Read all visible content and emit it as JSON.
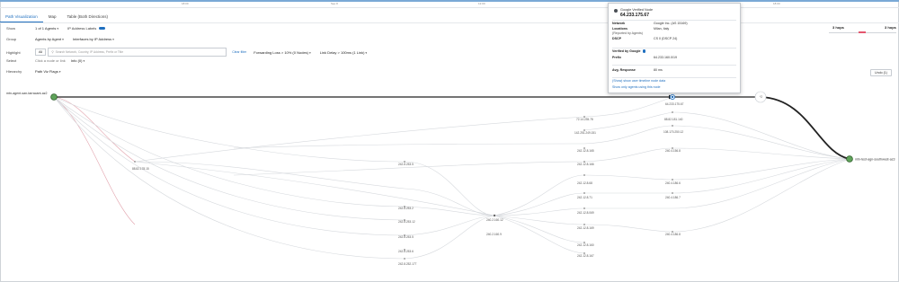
{
  "timeline": {
    "labels": [
      "18:00",
      "Sep 8",
      "12:00",
      "18:00"
    ]
  },
  "tabs": [
    {
      "label": "Path Visualization",
      "active": true
    },
    {
      "label": "Map",
      "active": false
    },
    {
      "label": "Table (Both Directions)",
      "active": false
    }
  ],
  "controls": {
    "show_label": "Show",
    "show_value": "1 of 1 Agents",
    "ip_labels": "IP Address Labels",
    "group_label": "Group",
    "group_value1": "Agents by Agent",
    "group_value2": "Interfaces by IP Address",
    "highlight_label": "Highlight",
    "highlight_select": "All",
    "highlight_placeholder": "Search Network, Country, IP Address, Prefix or Title",
    "clear_link": "Clear filter",
    "forwarding_loss": "Forwarding Loss > 10%  (0 Nodes)",
    "link_delay": "Link Delay > 100ms  (1 Link)",
    "select_label": "Select",
    "select_hint": "Click a node or link",
    "info_value": "Info (0)",
    "hierarchy_label": "Hierarchy",
    "hierarchy_value": "Path Viz Flags",
    "undo_label": "Undo (1)"
  },
  "hops": {
    "left": "3 hops",
    "right": "3 hops"
  },
  "popup": {
    "title": "Google Verified Node",
    "ip": "64.233.175.67",
    "network_label": "Network",
    "network_value": "Google Inc. (AS 15169)",
    "location_label": "Locations",
    "location_value": "Milan, Italy",
    "location_note": "(Reported by Agents)",
    "dscp_label": "DSCP",
    "dscp_value": "CS 0 (DSCP 24)",
    "verified_label": "Verified by Google",
    "prefix_label": "Prefix",
    "prefix_value": "64.233.160.0/19",
    "avg_label": "Avg. Response",
    "avg_value": "80 ms",
    "link1": "(Show) show user timeline node data",
    "link2": "Show only agents using this node"
  },
  "graph": {
    "source_label": "mtn-agent-san-tarracant-az2",
    "dest_label": "mtn-test-agn-southwest-az3",
    "nodes": [
      {
        "id": "n1",
        "label": "64.233.175.67"
      },
      {
        "id": "n2",
        "label": "72.14.235.78"
      },
      {
        "id": "n3",
        "label": "142.251.249.151"
      },
      {
        "id": "n4",
        "label": "88.82.178.15"
      },
      {
        "id": "n5",
        "label": "242.8.253.5"
      },
      {
        "id": "n6",
        "label": "242.8.253.2"
      },
      {
        "id": "n7",
        "label": "242.8.253.12"
      },
      {
        "id": "n8",
        "label": "242.8.253.5"
      },
      {
        "id": "n9",
        "label": "242.8.253.6"
      },
      {
        "id": "n10",
        "label": "242.8.252.177"
      },
      {
        "id": "n11",
        "label": "240.2.160.12"
      },
      {
        "id": "n12",
        "label": "240.2.160.9"
      },
      {
        "id": "n13",
        "label": "242.12.8.165"
      },
      {
        "id": "n14",
        "label": "242.12.8.166"
      },
      {
        "id": "n15",
        "label": "242.12.8.68"
      },
      {
        "id": "n16",
        "label": "242.12.8.71"
      },
      {
        "id": "n17",
        "label": "242.12.8.069"
      },
      {
        "id": "n18",
        "label": "242.12.8.169"
      },
      {
        "id": "n19",
        "label": "242.12.8.160"
      },
      {
        "id": "n20",
        "label": "242.12.8.167"
      },
      {
        "id": "n21",
        "label": "88.82.181.140"
      },
      {
        "id": "n22",
        "label": "108.170.250.12"
      },
      {
        "id": "n23",
        "label": "240.4.156.8"
      },
      {
        "id": "n24",
        "label": "240.4.186.6"
      },
      {
        "id": "n25",
        "label": "240.4.186.7"
      },
      {
        "id": "n26",
        "label": "240.4.186.8"
      },
      {
        "id": "n27",
        "label": "*2"
      }
    ]
  },
  "colors": {
    "accent": "#1f6fbf",
    "agent_node": "#5fa35a",
    "warn": "#e4566e"
  }
}
